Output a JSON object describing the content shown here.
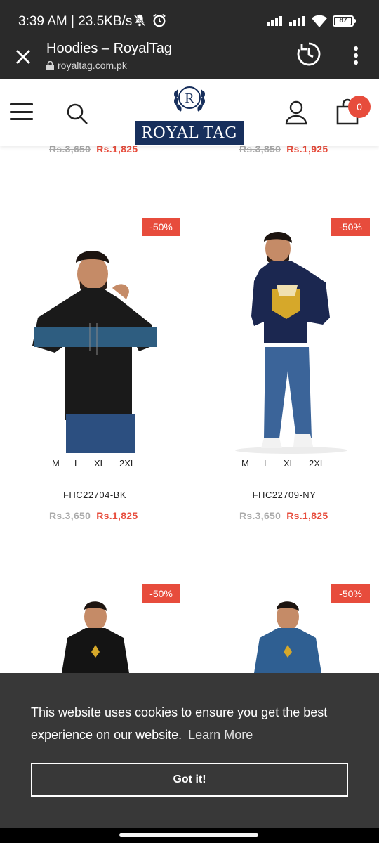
{
  "status_bar": {
    "time": "3:39 AM | 23.5KB/s",
    "battery_level": "87"
  },
  "browser": {
    "title": "Hoodies – RoyalTag",
    "url": "royaltag.com.pk"
  },
  "header": {
    "logo_letter": "R",
    "logo_text": "ROYAL TAG",
    "cart_count": "0"
  },
  "colors": {
    "sale": "#e74c3c",
    "brand_navy": "#172f5c",
    "cookie_bg": "#383838"
  },
  "top_prices": [
    {
      "old": "Rs.3,650",
      "new": "Rs.1,825"
    },
    {
      "old": "Rs.3,850",
      "new": "Rs.1,925"
    }
  ],
  "products": [
    {
      "badge": "-50%",
      "sizes": [
        "M",
        "L",
        "XL",
        "2XL"
      ],
      "sku": "FHC22704-BK",
      "old_price": "Rs.3,650",
      "new_price": "Rs.1,825"
    },
    {
      "badge": "-50%",
      "sizes": [
        "M",
        "L",
        "XL",
        "2XL"
      ],
      "sku": "FHC22709-NY",
      "old_price": "Rs.3,650",
      "new_price": "Rs.1,825"
    },
    {
      "badge": "-50%"
    },
    {
      "badge": "-50%"
    }
  ],
  "cookie": {
    "message": "This website uses cookies to ensure you get the best experience on our website.",
    "learn_more": "Learn More",
    "button": "Got it!"
  }
}
